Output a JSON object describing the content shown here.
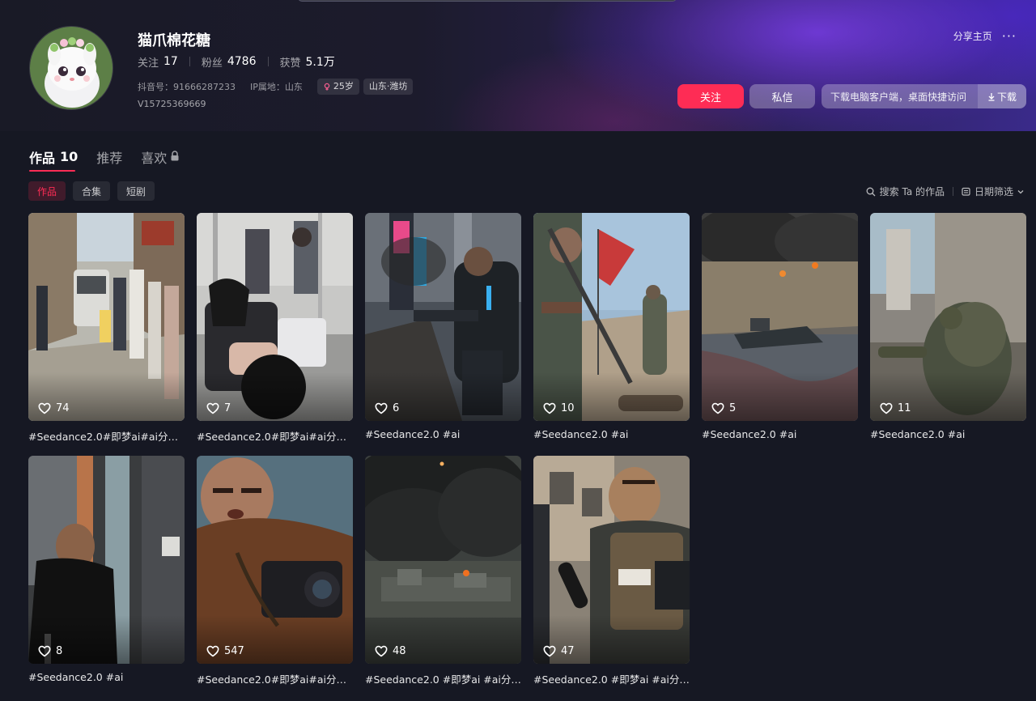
{
  "profile": {
    "nickname": "猫爪棉花糖",
    "stats": [
      {
        "label": "关注",
        "value": "17"
      },
      {
        "label": "粉丝",
        "value": "4786"
      },
      {
        "label": "获赞",
        "value": "5.1万"
      }
    ],
    "douyin_id": "抖音号：91666287233",
    "ip_location": "IP属地：山东",
    "age_tag": "25岁",
    "region_tag": "山东·潍坊",
    "uid_line": "V15725369669"
  },
  "actions": {
    "share_label": "分享主页",
    "more_label": "···",
    "follow_label": "关注",
    "message_label": "私信",
    "download_prompt": "下载电脑客户端，桌面快捷访问",
    "download_label": "下载"
  },
  "tabs": [
    {
      "label": "作品",
      "count": "10",
      "active": true
    },
    {
      "label": "推荐",
      "count": "",
      "active": false
    },
    {
      "label": "喜欢",
      "count": "",
      "active": false,
      "locked": true
    }
  ],
  "subtabs": [
    {
      "label": "作品",
      "active": true
    },
    {
      "label": "合集",
      "active": false
    },
    {
      "label": "短剧",
      "active": false
    }
  ],
  "tools": {
    "search_label": "搜索 Ta 的作品",
    "date_filter_label": "日期筛选"
  },
  "colors": {
    "accent": "#fe2c55",
    "background": "#161823"
  },
  "videos": [
    {
      "likes": "74",
      "caption": "#Seedance2.0#即梦ai#ai分…",
      "scene": "street"
    },
    {
      "likes": "7",
      "caption": "#Seedance2.0#即梦ai#ai分…",
      "scene": "subway"
    },
    {
      "likes": "6",
      "caption": "#Seedance2.0 #ai",
      "scene": "scifi"
    },
    {
      "likes": "10",
      "caption": "#Seedance2.0 #ai",
      "scene": "flag"
    },
    {
      "likes": "5",
      "caption": "#Seedance2.0 #ai",
      "scene": "beach"
    },
    {
      "likes": "11",
      "caption": "#Seedance2.0 #ai",
      "scene": "alley"
    },
    {
      "likes": "8",
      "caption": "#Seedance2.0 #ai",
      "scene": "ruin"
    },
    {
      "likes": "547",
      "caption": "#Seedance2.0#即梦ai#ai分…",
      "scene": "camera"
    },
    {
      "likes": "48",
      "caption": "#Seedance2.0 #即梦ai #ai分…",
      "scene": "smoke"
    },
    {
      "likes": "47",
      "caption": "#Seedance2.0 #即梦ai #ai分…",
      "scene": "press"
    }
  ]
}
